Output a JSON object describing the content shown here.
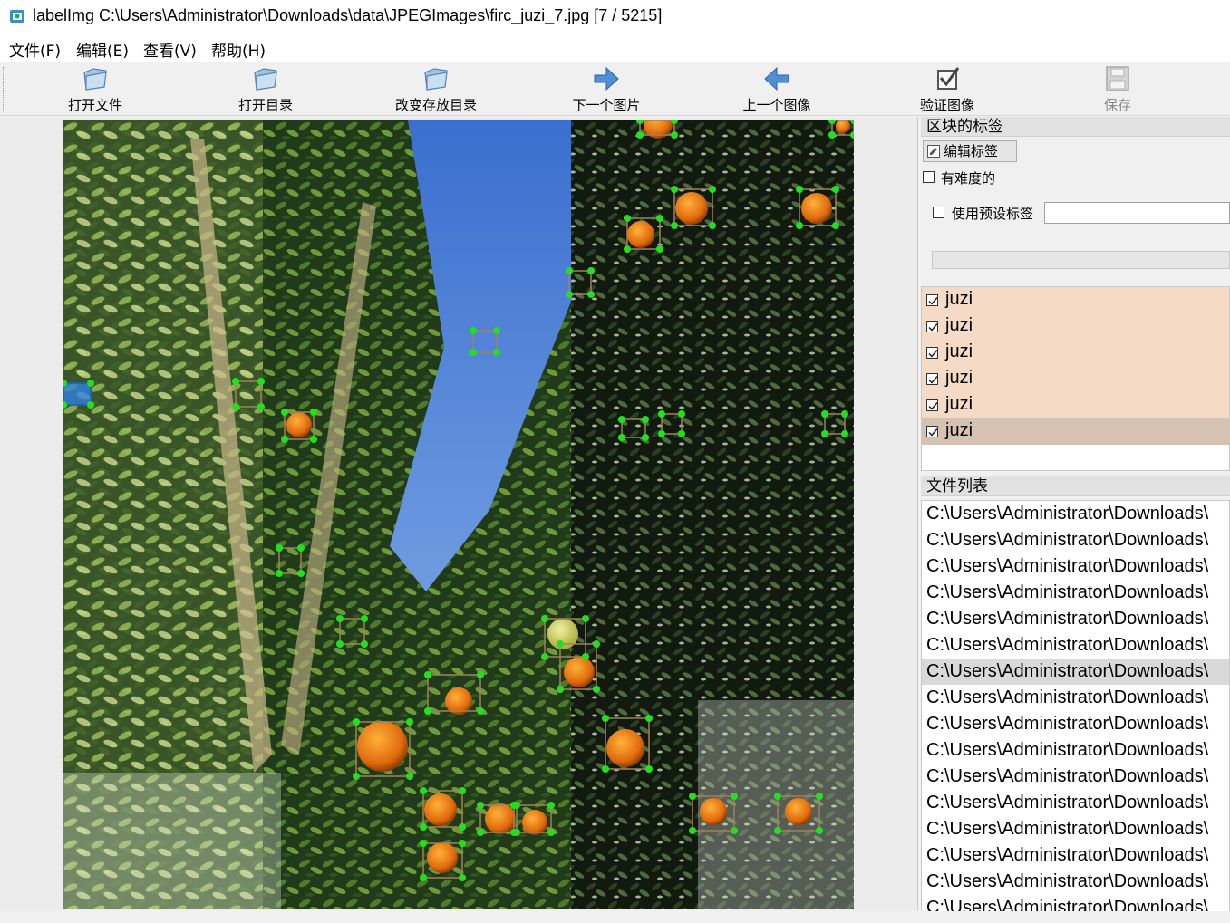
{
  "window": {
    "title": "labelImg C:\\Users\\Administrator\\Downloads\\data\\JPEGImages\\firc_juzi_7.jpg [7 / 5215]"
  },
  "menu": [
    {
      "label": "文件(F)"
    },
    {
      "label": "编辑(E)"
    },
    {
      "label": "查看(V)"
    },
    {
      "label": "帮助(H)"
    }
  ],
  "toolbar": [
    {
      "label": "打开文件",
      "icon": "open-file-icon",
      "enabled": true
    },
    {
      "label": "打开目录",
      "icon": "open-dir-icon",
      "enabled": true
    },
    {
      "label": "改变存放目录",
      "icon": "change-save-dir-icon",
      "enabled": true
    },
    {
      "label": "下一个图片",
      "icon": "next-image-icon",
      "enabled": true
    },
    {
      "label": "上一个图像",
      "icon": "prev-image-icon",
      "enabled": true
    },
    {
      "label": "验证图像",
      "icon": "verify-image-icon",
      "enabled": true
    },
    {
      "label": "保存",
      "icon": "save-icon",
      "enabled": false
    }
  ],
  "box_labels_panel": {
    "title": "区块的标签",
    "edit_label_button": "编辑标签",
    "difficult_label": "有难度的",
    "difficult_checked": false,
    "use_default_label": "使用预设标签",
    "use_default_checked": false,
    "default_label_value": "",
    "labels": [
      {
        "text": "juzi",
        "checked": true,
        "selected": false
      },
      {
        "text": "juzi",
        "checked": true,
        "selected": false
      },
      {
        "text": "juzi",
        "checked": true,
        "selected": false
      },
      {
        "text": "juzi",
        "checked": true,
        "selected": false
      },
      {
        "text": "juzi",
        "checked": true,
        "selected": false
      },
      {
        "text": "juzi",
        "checked": true,
        "selected": true
      }
    ]
  },
  "file_list_panel": {
    "title": "文件列表",
    "files": [
      {
        "path": "C:\\Users\\Administrator\\Downloads\\",
        "selected": false
      },
      {
        "path": "C:\\Users\\Administrator\\Downloads\\",
        "selected": false
      },
      {
        "path": "C:\\Users\\Administrator\\Downloads\\",
        "selected": false
      },
      {
        "path": "C:\\Users\\Administrator\\Downloads\\",
        "selected": false
      },
      {
        "path": "C:\\Users\\Administrator\\Downloads\\",
        "selected": false
      },
      {
        "path": "C:\\Users\\Administrator\\Downloads\\",
        "selected": false
      },
      {
        "path": "C:\\Users\\Administrator\\Downloads\\",
        "selected": true
      },
      {
        "path": "C:\\Users\\Administrator\\Downloads\\",
        "selected": false
      },
      {
        "path": "C:\\Users\\Administrator\\Downloads\\",
        "selected": false
      },
      {
        "path": "C:\\Users\\Administrator\\Downloads\\",
        "selected": false
      },
      {
        "path": "C:\\Users\\Administrator\\Downloads\\",
        "selected": false
      },
      {
        "path": "C:\\Users\\Administrator\\Downloads\\",
        "selected": false
      },
      {
        "path": "C:\\Users\\Administrator\\Downloads\\",
        "selected": false
      },
      {
        "path": "C:\\Users\\Administrator\\Downloads\\",
        "selected": false
      },
      {
        "path": "C:\\Users\\Administrator\\Downloads\\",
        "selected": false
      },
      {
        "path": "C:\\Users\\Administrator\\Downloads\\",
        "selected": false
      }
    ]
  },
  "colors": {
    "label_row_bg": "#f5dbc6",
    "label_row_selected_bg": "#d6c2b1",
    "bbox_vertex": "#22e01f",
    "bbox_edge": "#a0825a",
    "selected_bbox_fill": "#2f7fe0"
  }
}
